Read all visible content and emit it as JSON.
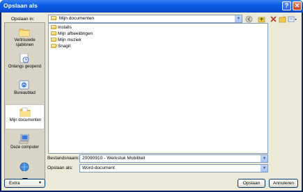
{
  "window": {
    "title": "Opslaan als",
    "help_glyph": "?",
    "close_glyph": "✕"
  },
  "location": {
    "label": "Opslaan in:",
    "value": "Mijn documenten"
  },
  "toolbar": [
    "back-icon",
    "up-folder-icon",
    "delete-icon",
    "new-folder-icon",
    "views-icon"
  ],
  "places": [
    {
      "id": "recent",
      "label": "Vertrouwde sjablonen"
    },
    {
      "id": "history",
      "label": "Onlangs geopend"
    },
    {
      "id": "desktop",
      "label": "Bureaublad"
    },
    {
      "id": "mydocs",
      "label": "Mijn documenten",
      "selected": true
    },
    {
      "id": "computer",
      "label": "Deze computer"
    }
  ],
  "files": [
    {
      "name": "Installs",
      "icon": "folder-icon"
    },
    {
      "name": "Mijn afbeeldingen",
      "icon": "pictures-folder-icon"
    },
    {
      "name": "Mijn muziek",
      "icon": "music-folder-icon"
    },
    {
      "name": "Snagit",
      "icon": "folder-icon"
    }
  ],
  "filename": {
    "label": "Bestandsnaam:",
    "value": "20090910 - Werkstuk Mobiliteit"
  },
  "filetype": {
    "label": "Opslaan als:",
    "value": "Word-document"
  },
  "buttons": {
    "extra": "Extra",
    "save": "Opslaan",
    "cancel": "Annuleren"
  },
  "colors": {
    "title_bar": "#0a50d6",
    "dialog_bg": "#ece9d8",
    "places_bg": "#d8d4c6",
    "border": "#7f9db9"
  }
}
